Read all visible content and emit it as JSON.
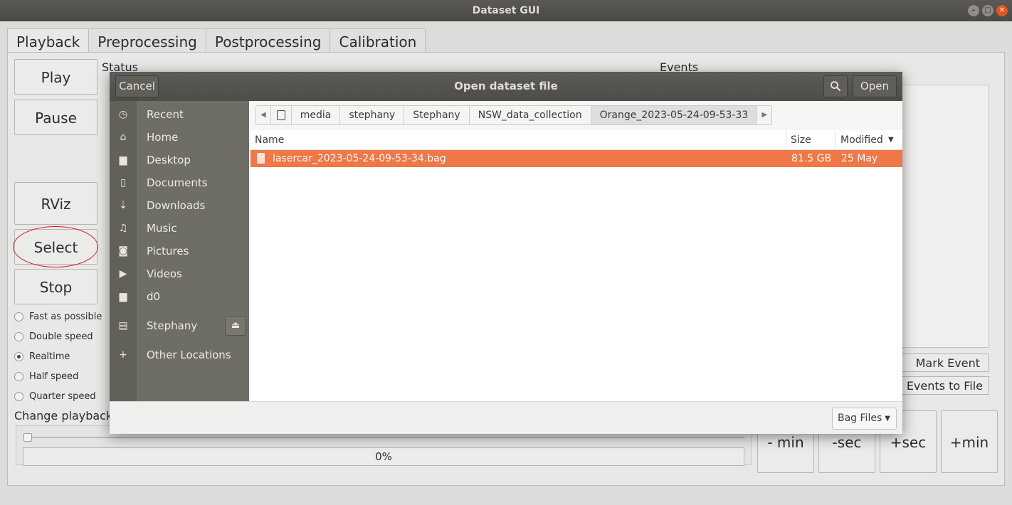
{
  "window": {
    "title": "Dataset GUI"
  },
  "tabs": [
    {
      "label": "Playback"
    },
    {
      "label": "Preprocessing"
    },
    {
      "label": "Postprocessing"
    },
    {
      "label": "Calibration"
    }
  ],
  "playback": {
    "buttons": {
      "play": "Play",
      "pause": "Pause",
      "rviz": "RViz",
      "select": "Select",
      "stop": "Stop"
    },
    "speeds": [
      {
        "label": "Fast as possible",
        "selected": false
      },
      {
        "label": "Double speed",
        "selected": false
      },
      {
        "label": "Realtime",
        "selected": true
      },
      {
        "label": "Half speed",
        "selected": false
      },
      {
        "label": "Quarter speed",
        "selected": false
      }
    ],
    "status_label": "Status",
    "events_label": "Events",
    "change_time_label": "Change playback ti",
    "progress_text": "0%",
    "progress_value": 0,
    "mark_event": "Mark Event",
    "events_to_file": "Events to File",
    "seek": {
      "minus_min": "- min",
      "minus_sec": "-sec",
      "plus_sec": "+sec",
      "plus_min": "+min"
    }
  },
  "dialog": {
    "title": "Open dataset file",
    "cancel": "Cancel",
    "open": "Open",
    "sidebar": [
      {
        "label": "Recent",
        "icon": "clock-icon"
      },
      {
        "label": "Home",
        "icon": "home-icon"
      },
      {
        "label": "Desktop",
        "icon": "folder-icon"
      },
      {
        "label": "Documents",
        "icon": "document-icon"
      },
      {
        "label": "Downloads",
        "icon": "download-icon"
      },
      {
        "label": "Music",
        "icon": "music-icon"
      },
      {
        "label": "Pictures",
        "icon": "camera-icon"
      },
      {
        "label": "Videos",
        "icon": "video-icon"
      },
      {
        "label": "d0",
        "icon": "folder-icon"
      },
      {
        "label": "Stephany",
        "icon": "drive-icon"
      },
      {
        "label": "Other Locations",
        "icon": "plus-icon"
      }
    ],
    "path": [
      "media",
      "stephany",
      "Stephany",
      "NSW_data_collection",
      "Orange_2023-05-24-09-53-33"
    ],
    "columns": {
      "name": "Name",
      "size": "Size",
      "modified": "Modified"
    },
    "files": [
      {
        "name": "lasercar_2023-05-24-09-53-34.bag",
        "size": "81.5 GB",
        "modified": "25 May",
        "selected": true
      }
    ],
    "filter": "Bag Files"
  },
  "colors": {
    "selection": "#f07746",
    "annotation_circle": "#e0191c",
    "header_bg": "#4d4c48"
  }
}
